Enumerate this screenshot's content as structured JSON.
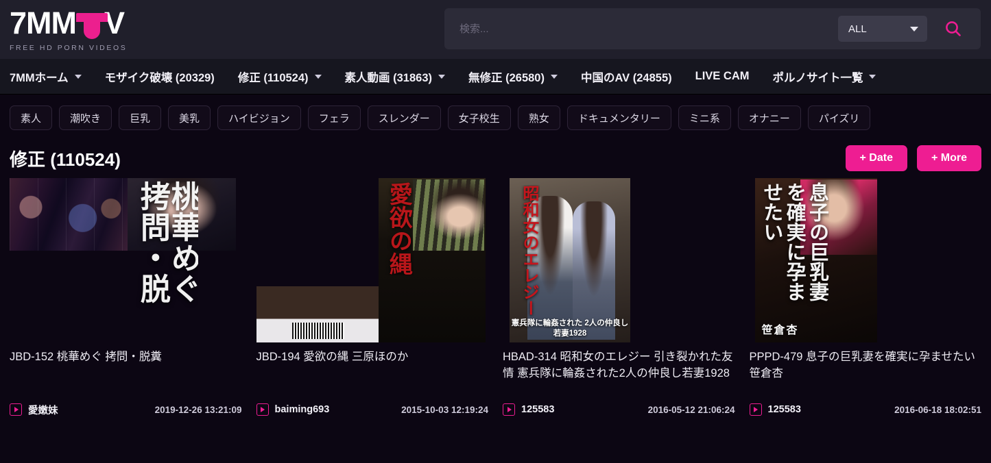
{
  "site": {
    "logo_text_left": "7MM",
    "logo_text_right": "V",
    "logo_icon": "panty-icon",
    "tagline": "FREE HD PORN VIDEOS",
    "brand_color": "#ee1d92",
    "header_bg": "#201f2b",
    "page_bg": "#0c0613"
  },
  "search": {
    "placeholder": "検索...",
    "value": "",
    "category_selected": "ALL",
    "search_icon": "magnifier-icon",
    "dropdown_icon": "chevron-down-icon"
  },
  "nav": {
    "items": [
      {
        "label": "7MMホーム",
        "has_dropdown": true
      },
      {
        "label": "モザイク破壊 (20329)",
        "has_dropdown": false
      },
      {
        "label": "修正 (110524)",
        "has_dropdown": true
      },
      {
        "label": "素人動画 (31863)",
        "has_dropdown": true
      },
      {
        "label": "無修正 (26580)",
        "has_dropdown": true
      },
      {
        "label": "中国のAV (24855)",
        "has_dropdown": false
      },
      {
        "label": "LIVE CAM",
        "has_dropdown": false
      },
      {
        "label": "ポルノサイト一覧",
        "has_dropdown": true
      }
    ]
  },
  "tags": [
    "素人",
    "潮吹き",
    "巨乳",
    "美乳",
    "ハイビジョン",
    "フェラ",
    "スレンダー",
    "女子校生",
    "熟女",
    "ドキュメンタリー",
    "ミニ系",
    "オナニー",
    "パイズリ"
  ],
  "page": {
    "title": "修正 (110524)",
    "date_button": "+ Date",
    "more_button": "+ More"
  },
  "videos": [
    {
      "title": "JBD-152 桃華めぐ 拷問・脱糞",
      "uploader": "愛嫩妹",
      "date": "2019-12-26 13:21:09",
      "cover_text": "桃華めぐ 拷問・脱"
    },
    {
      "title": "JBD-194 愛欲の縄 三原ほのか",
      "uploader": "baiming693",
      "date": "2015-10-03 12:19:24",
      "cover_text": "愛欲の縄"
    },
    {
      "title": "HBAD-314 昭和女のエレジー 引き裂かれた友情 憲兵隊に輪姦された2人の仲良し若妻1928",
      "uploader": "125583",
      "date": "2016-05-12 21:06:24",
      "cover_text": "昭和女のエレジー",
      "cover_caption": "憲兵隊に輪姦された 2人の仲良し若妻1928"
    },
    {
      "title": "PPPD-479 息子の巨乳妻を確実に孕ませたい 笹倉杏",
      "uploader": "125583",
      "date": "2016-06-18 18:02:51",
      "cover_text": "息子の巨乳妻を確実に孕ませたい",
      "cover_actress": "笹倉杏"
    }
  ]
}
